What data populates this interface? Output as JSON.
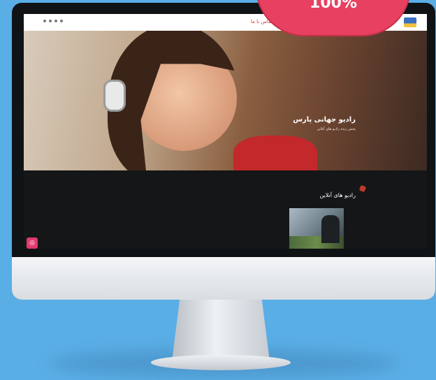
{
  "topbar": {
    "nav_label": "تماس با ما",
    "social_icons": [
      "social-dot",
      "social-dot",
      "social-dot",
      "social-dot"
    ]
  },
  "hero": {
    "title": "رادیو جهانی پارس",
    "subtitle": "پخش زنده رادیو های آنلاین"
  },
  "section": {
    "heading": "رادیو های آنلاین"
  },
  "promo": {
    "text": "100%"
  },
  "colors": {
    "background": "#5aaee6",
    "accent": "#e84060",
    "hero_title": "#ffffff"
  }
}
